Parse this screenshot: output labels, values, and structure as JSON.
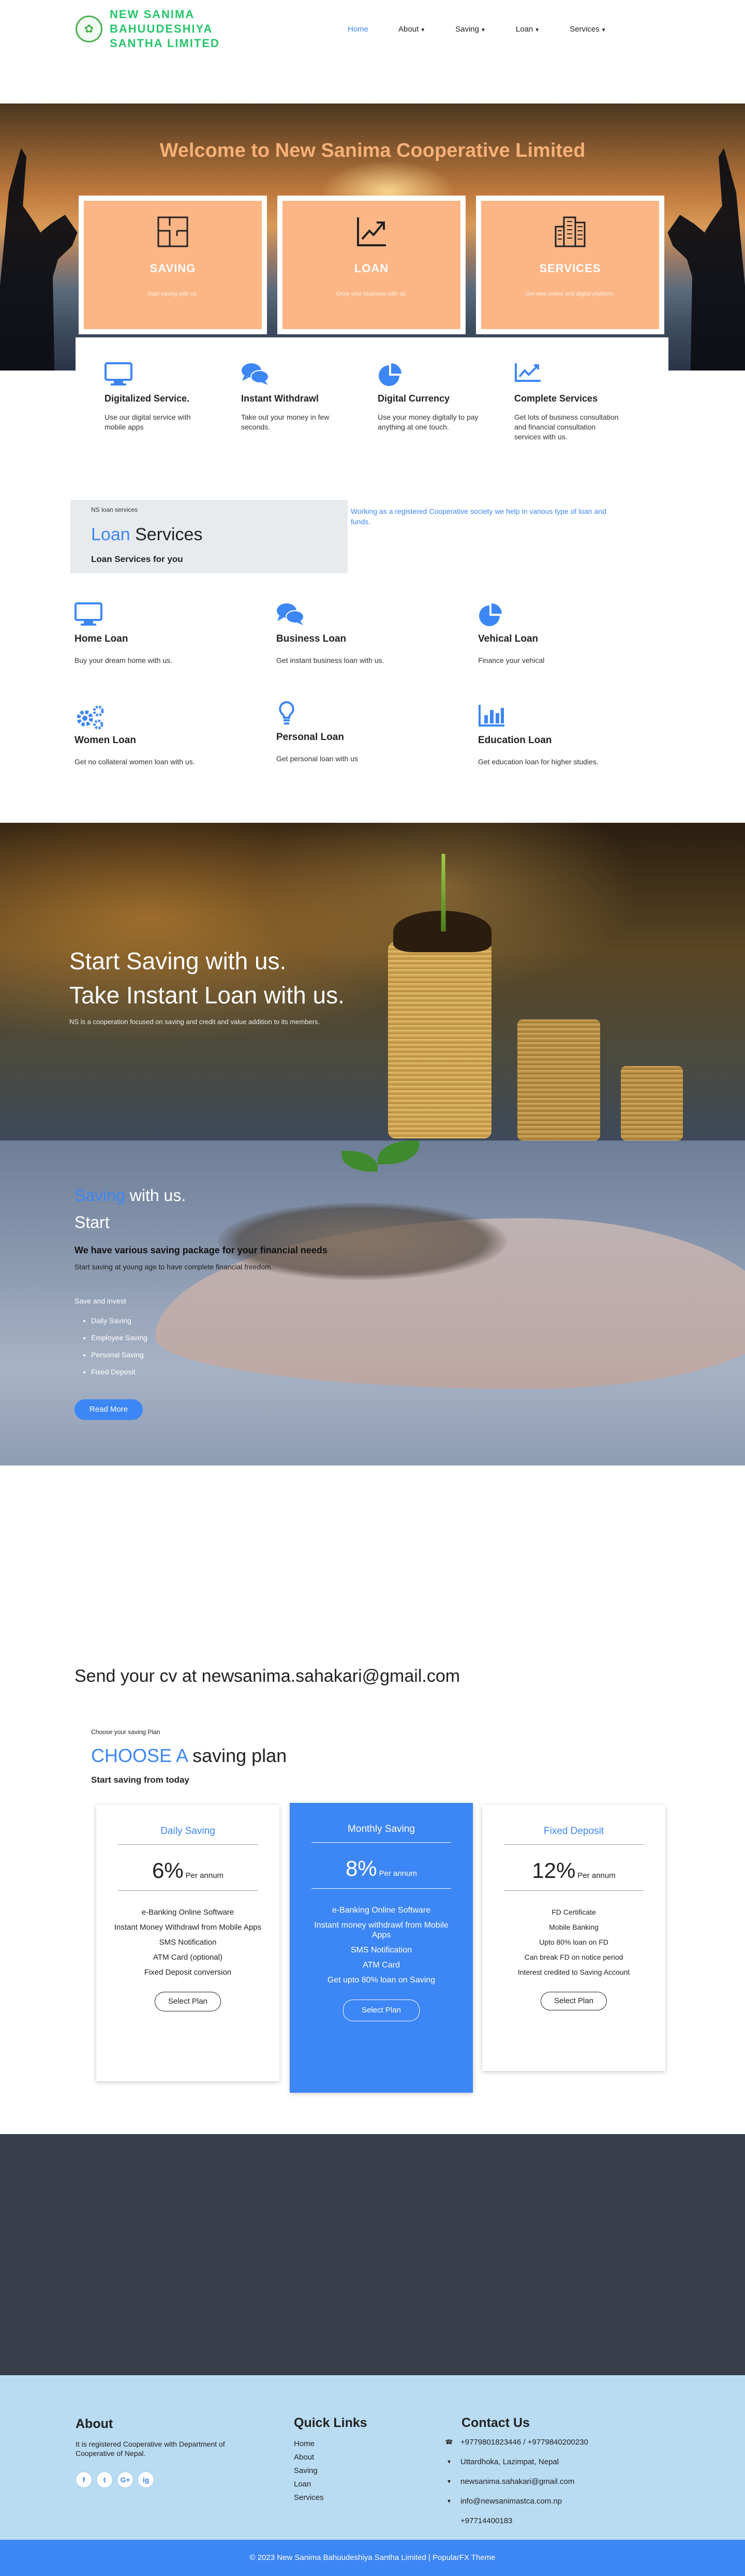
{
  "header": {
    "logo_text": "NEW SANIMA BAHUUDESHIYA SANTHA LIMITED",
    "nav": [
      {
        "label": "Home",
        "active": true,
        "dropdown": false
      },
      {
        "label": "About",
        "active": false,
        "dropdown": true
      },
      {
        "label": "Saving",
        "active": false,
        "dropdown": true
      },
      {
        "label": "Loan",
        "active": false,
        "dropdown": true
      },
      {
        "label": "Services",
        "active": false,
        "dropdown": true
      }
    ]
  },
  "hero": {
    "title": "Welcome to New Sanima Cooperative Limited",
    "cards": [
      {
        "icon": "floorplan-icon",
        "title": "SAVING",
        "desc": "Start saving with us."
      },
      {
        "icon": "chart-growth-icon",
        "title": "LOAN",
        "desc": "Grow your business with us."
      },
      {
        "icon": "building-icon",
        "title": "SERVICES",
        "desc": "Get new online and digital platform."
      }
    ]
  },
  "features": [
    {
      "icon": "monitor-icon",
      "title": "Digitalized Service.",
      "desc": "Use our digital service with mobile apps"
    },
    {
      "icon": "chat-icon",
      "title": "Instant Withdrawl",
      "desc": "Take out your money in few seconds."
    },
    {
      "icon": "pie-chart-icon",
      "title": "Digital Currency",
      "desc": "Use your money digitally to pay anything at one touch."
    },
    {
      "icon": "line-chart-icon",
      "title": "Complete Services",
      "desc": "Get lots of business consultation and financial consultation services with us."
    }
  ],
  "loan": {
    "small": "NS loan services",
    "heading_blue": "Loan",
    "heading_rest": " Services",
    "sub": "Loan Services for you",
    "side": "Working as a registered Cooperative society we help in various type of loan and funds.",
    "items": [
      {
        "icon": "monitor-icon",
        "title": "Home Loan",
        "desc": "Buy your dream home with us."
      },
      {
        "icon": "chat-icon",
        "title": "Business Loan",
        "desc": "Get instant business loan with us."
      },
      {
        "icon": "pie-chart-icon",
        "title": "Vehical Loan",
        "desc": "Finance your vehical"
      },
      {
        "icon": "gears-icon",
        "title": "Women Loan",
        "desc": "Get no collateral women loan with us."
      },
      {
        "icon": "lightbulb-icon",
        "title": "Personal Loan",
        "desc": "Get personal loan with us"
      },
      {
        "icon": "bar-chart-icon",
        "title": "Education Loan",
        "desc": "Get education loan for higher studies."
      }
    ]
  },
  "banner": {
    "line1": "Start Saving with us.",
    "line2": "Take Instant Loan with us.",
    "desc": "NS is a cooperation focused on saving and credit and value addition to its members."
  },
  "saving": {
    "title_blue": "Saving",
    "title_rest": " with us.",
    "start": "Start",
    "bold": "We have various saving package for your financial needs",
    "desc": "Start saving at young age to have complete financial freedom.",
    "save_invest": "Save and invest",
    "list": [
      "Daily Saving",
      "Employee Saving",
      "Personal Saving",
      "Fixed Deposit"
    ],
    "button": "Read More"
  },
  "cv": "Send your cv at newsanima.sahakari@gmail.com",
  "plans": {
    "small": "Choose your saving Plan",
    "heading_blue": "CHOOSE A",
    "heading_rest": " saving plan",
    "sub": "Start saving from today",
    "items": [
      {
        "name": "Daily Saving",
        "rate": "6%",
        "per": "Per annum",
        "features": [
          "e-Banking Online Software",
          "Instant Money Withdrawl from Mobile Apps",
          "SMS Notification",
          "ATM Card (optional)",
          "Fixed Deposit conversion"
        ],
        "button": "Select Plan"
      },
      {
        "name": "Monthly Saving",
        "rate": "8%",
        "per": "Per annum",
        "features": [
          "e-Banking Online Software",
          "Instant money withdrawl from Mobile Apps",
          "SMS Notification",
          "ATM Card",
          "Get upto 80% loan on Saving"
        ],
        "button": "Select Plan"
      },
      {
        "name": "Fixed Deposit",
        "rate": "12%",
        "per": "Per annum",
        "features": [
          "FD Certificate",
          "Mobile Banking",
          "Upto 80% loan on FD",
          "Can break FD on notice period",
          "Interest credited to Saving Account"
        ],
        "button": "Select Plan"
      }
    ]
  },
  "footer": {
    "about_title": "About",
    "about_text": "It is registered Cooperative with Department of Cooperative of Nepal.",
    "social": [
      "f",
      "t",
      "G+",
      "ig"
    ],
    "ql_title": "Quick Links",
    "links": [
      "Home",
      "About",
      "Saving",
      "Loan",
      "Services"
    ],
    "contact_title": "Contact Us",
    "contact": [
      {
        "icon": "phone-icon",
        "text": "+9779801823446 / +9779840200230"
      },
      {
        "icon": "map-pin-icon",
        "text": "Uttardhoka, Lazimpat, Nepal"
      },
      {
        "icon": "envelope-icon",
        "text": "newsanima.sahakari@gmail.com"
      },
      {
        "icon": "envelope-icon",
        "text": "info@newsanimastca.com.np"
      },
      {
        "icon": "phone-icon",
        "text": "+97714400183"
      }
    ],
    "copyright": "© 2023 New Sanima Bahuudeshiya Santha Limited | PopularFX Theme"
  },
  "colors": {
    "accent": "#3d86f5",
    "peach": "#fcb585",
    "logo_green": "#27c46b",
    "dark": "#393f4a",
    "footer_bg": "#b9dcf3"
  }
}
